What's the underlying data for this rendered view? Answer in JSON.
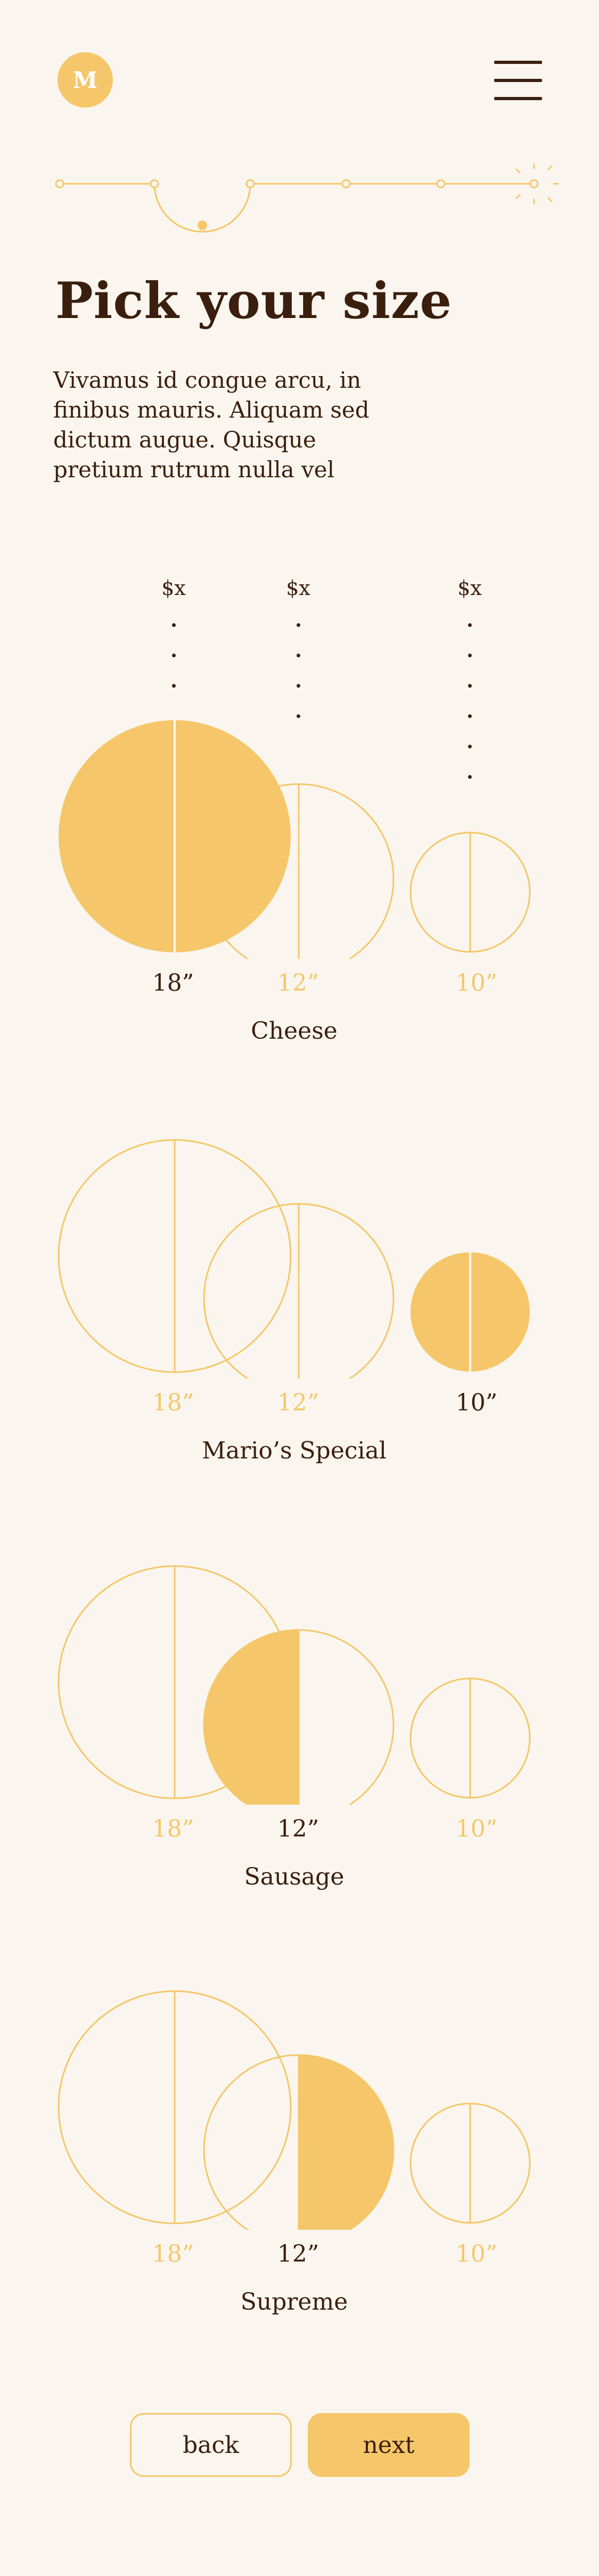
{
  "brand": {
    "logo_letter": "M"
  },
  "header": {
    "menu_icon": "hamburger-menu-icon"
  },
  "progress": {
    "total_steps": 6,
    "current_step": 2
  },
  "page": {
    "title": "Pick your size",
    "intro": "Vivamus id congue arcu, in finibus mauris. Aliquam sed dictum augue. Quisque pretium rutrum nulla vel"
  },
  "prices": [
    "$x",
    "$x",
    "$x"
  ],
  "sizes": [
    "18”",
    "12”",
    "10”"
  ],
  "pizzas": [
    {
      "name": "Cheese",
      "selected_size": "18”"
    },
    {
      "name": "Mario’s Special",
      "selected_size": "10”"
    },
    {
      "name": "Sausage",
      "selected_size": "12”"
    },
    {
      "name": "Supreme",
      "selected_size": "12”"
    }
  ],
  "nav": {
    "back_label": "back",
    "next_label": "next"
  },
  "colors": {
    "accent": "#f5c76a",
    "text": "#3b1f0e",
    "background": "#faf6ef"
  }
}
